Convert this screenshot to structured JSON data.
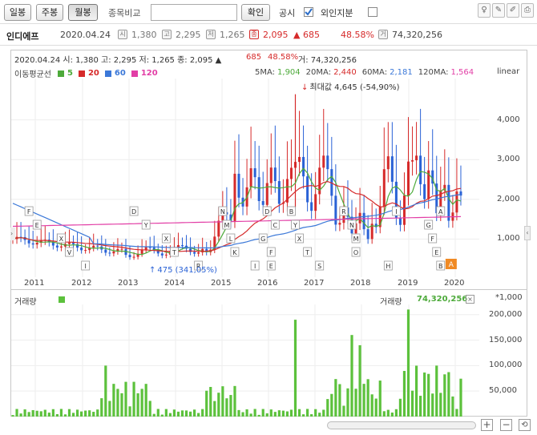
{
  "toolbar": {
    "daily_label": "일봉",
    "weekly_label": "주봉",
    "monthly_label": "월봉",
    "compare_label": "종목비교",
    "confirm_label": "확인",
    "disclosure_label": "공시",
    "foreign_label": "외인지분",
    "disclosure_checked": true,
    "foreign_checked": false
  },
  "stock": {
    "name": "인디에프",
    "date": "2020.04.24",
    "open_icon": "시",
    "open": "1,380",
    "high_icon": "고",
    "high": "2,295",
    "low_icon": "저",
    "low": "1,265",
    "close_icon": "종",
    "close": "2,095",
    "change": "▲ 685",
    "change_pct": "48.58%",
    "volume_icon": "거",
    "volume": "74,320,256"
  },
  "chart_header": {
    "line": "2020.04.24 시: 1,380 고: 2,295 저: 1,265 종: 2,095 ▲",
    "change": "685",
    "pct": "48.58%",
    "vol": "거: 74,320,256",
    "scale_label": "linear"
  },
  "ma_legend": {
    "label": "이동평균선",
    "items": [
      {
        "label": "5",
        "color": "#4daa3a"
      },
      {
        "label": "20",
        "color": "#d62a2a"
      },
      {
        "label": "60",
        "color": "#3b78d8"
      },
      {
        "label": "120",
        "color": "#e23ea6"
      }
    ]
  },
  "ma_values": [
    {
      "label": "5MA:",
      "value": "1,904",
      "color": "#4daa3a"
    },
    {
      "label": "20MA:",
      "value": "2,440",
      "color": "#d62a2a"
    },
    {
      "label": "60MA:",
      "value": "2,181",
      "color": "#3b78d8"
    },
    {
      "label": "120MA:",
      "value": "1,564",
      "color": "#e23ea6"
    }
  ],
  "annotations": {
    "max_label": "최대값 4,645 (-54,90%)",
    "min_label": "475 (341,05%)"
  },
  "chart_data": {
    "type": "line",
    "title": "",
    "x_ticks": [
      "2011",
      "2012",
      "2013",
      "2014",
      "2015",
      "2016",
      "2017",
      "2018",
      "2019",
      "2020"
    ],
    "y_ticks": [
      "4,000",
      "3,000",
      "2,000",
      "1,000"
    ],
    "ylim": [
      0,
      5000
    ],
    "scale": "linear",
    "max": 4645,
    "min": 475,
    "volume_label": "거래량",
    "volume_value": "74,320,256",
    "volume_unit": "*1,000",
    "volume_ticks": [
      "200,000",
      "150,000",
      "100,000",
      "50,000"
    ],
    "series": [
      {
        "name": "5",
        "color": "#4daa3a"
      },
      {
        "name": "20",
        "color": "#d62a2a"
      },
      {
        "name": "60",
        "color": "#3b78d8"
      },
      {
        "name": "120",
        "color": "#e23ea6"
      }
    ]
  },
  "colors": {
    "up": "#d62a2a",
    "down": "#2a62d6",
    "volume": "#5cc13c"
  }
}
